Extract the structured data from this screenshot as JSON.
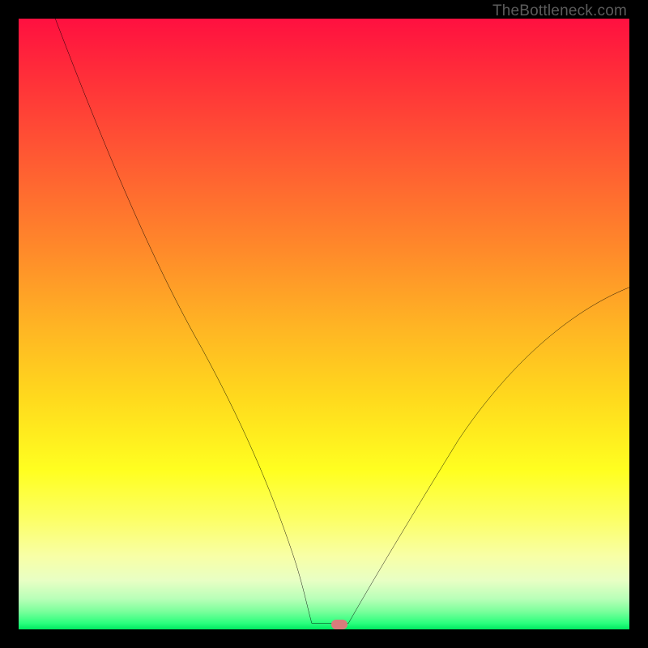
{
  "watermark": "TheBottleneck.com",
  "marker": {
    "x_pct": 52.5,
    "y_pct": 99.2,
    "color": "#d97c7c"
  },
  "chart_data": {
    "type": "line",
    "title": "",
    "xlabel": "",
    "ylabel": "",
    "xlim": [
      0,
      100
    ],
    "ylim": [
      0,
      100
    ],
    "grid": false,
    "legend": false,
    "description": "Bottleneck curve: a V-shaped curve descending from the top-left to a small flat minimum near the bottom (around x≈50) then ascending toward the right edge. Background is a vertical heat gradient from red (top, bad) through yellow to green (bottom, good). A small rounded marker sits at the minimum.",
    "series": [
      {
        "name": "bottleneck-left",
        "x": [
          6,
          10,
          14,
          18,
          22,
          26,
          30,
          34,
          38,
          42,
          46,
          48
        ],
        "y": [
          100,
          92,
          84,
          76,
          68,
          60,
          52,
          43,
          33,
          22,
          9,
          1
        ]
      },
      {
        "name": "flat-min",
        "x": [
          48,
          54
        ],
        "y": [
          1,
          1
        ]
      },
      {
        "name": "bottleneck-right",
        "x": [
          54,
          58,
          62,
          66,
          70,
          74,
          78,
          82,
          86,
          90,
          94,
          98,
          100
        ],
        "y": [
          1,
          7,
          13,
          19,
          24,
          29,
          34,
          39,
          43,
          47,
          51,
          54,
          56
        ]
      }
    ],
    "marker_point": {
      "x": 52.5,
      "y": 0.8
    }
  }
}
